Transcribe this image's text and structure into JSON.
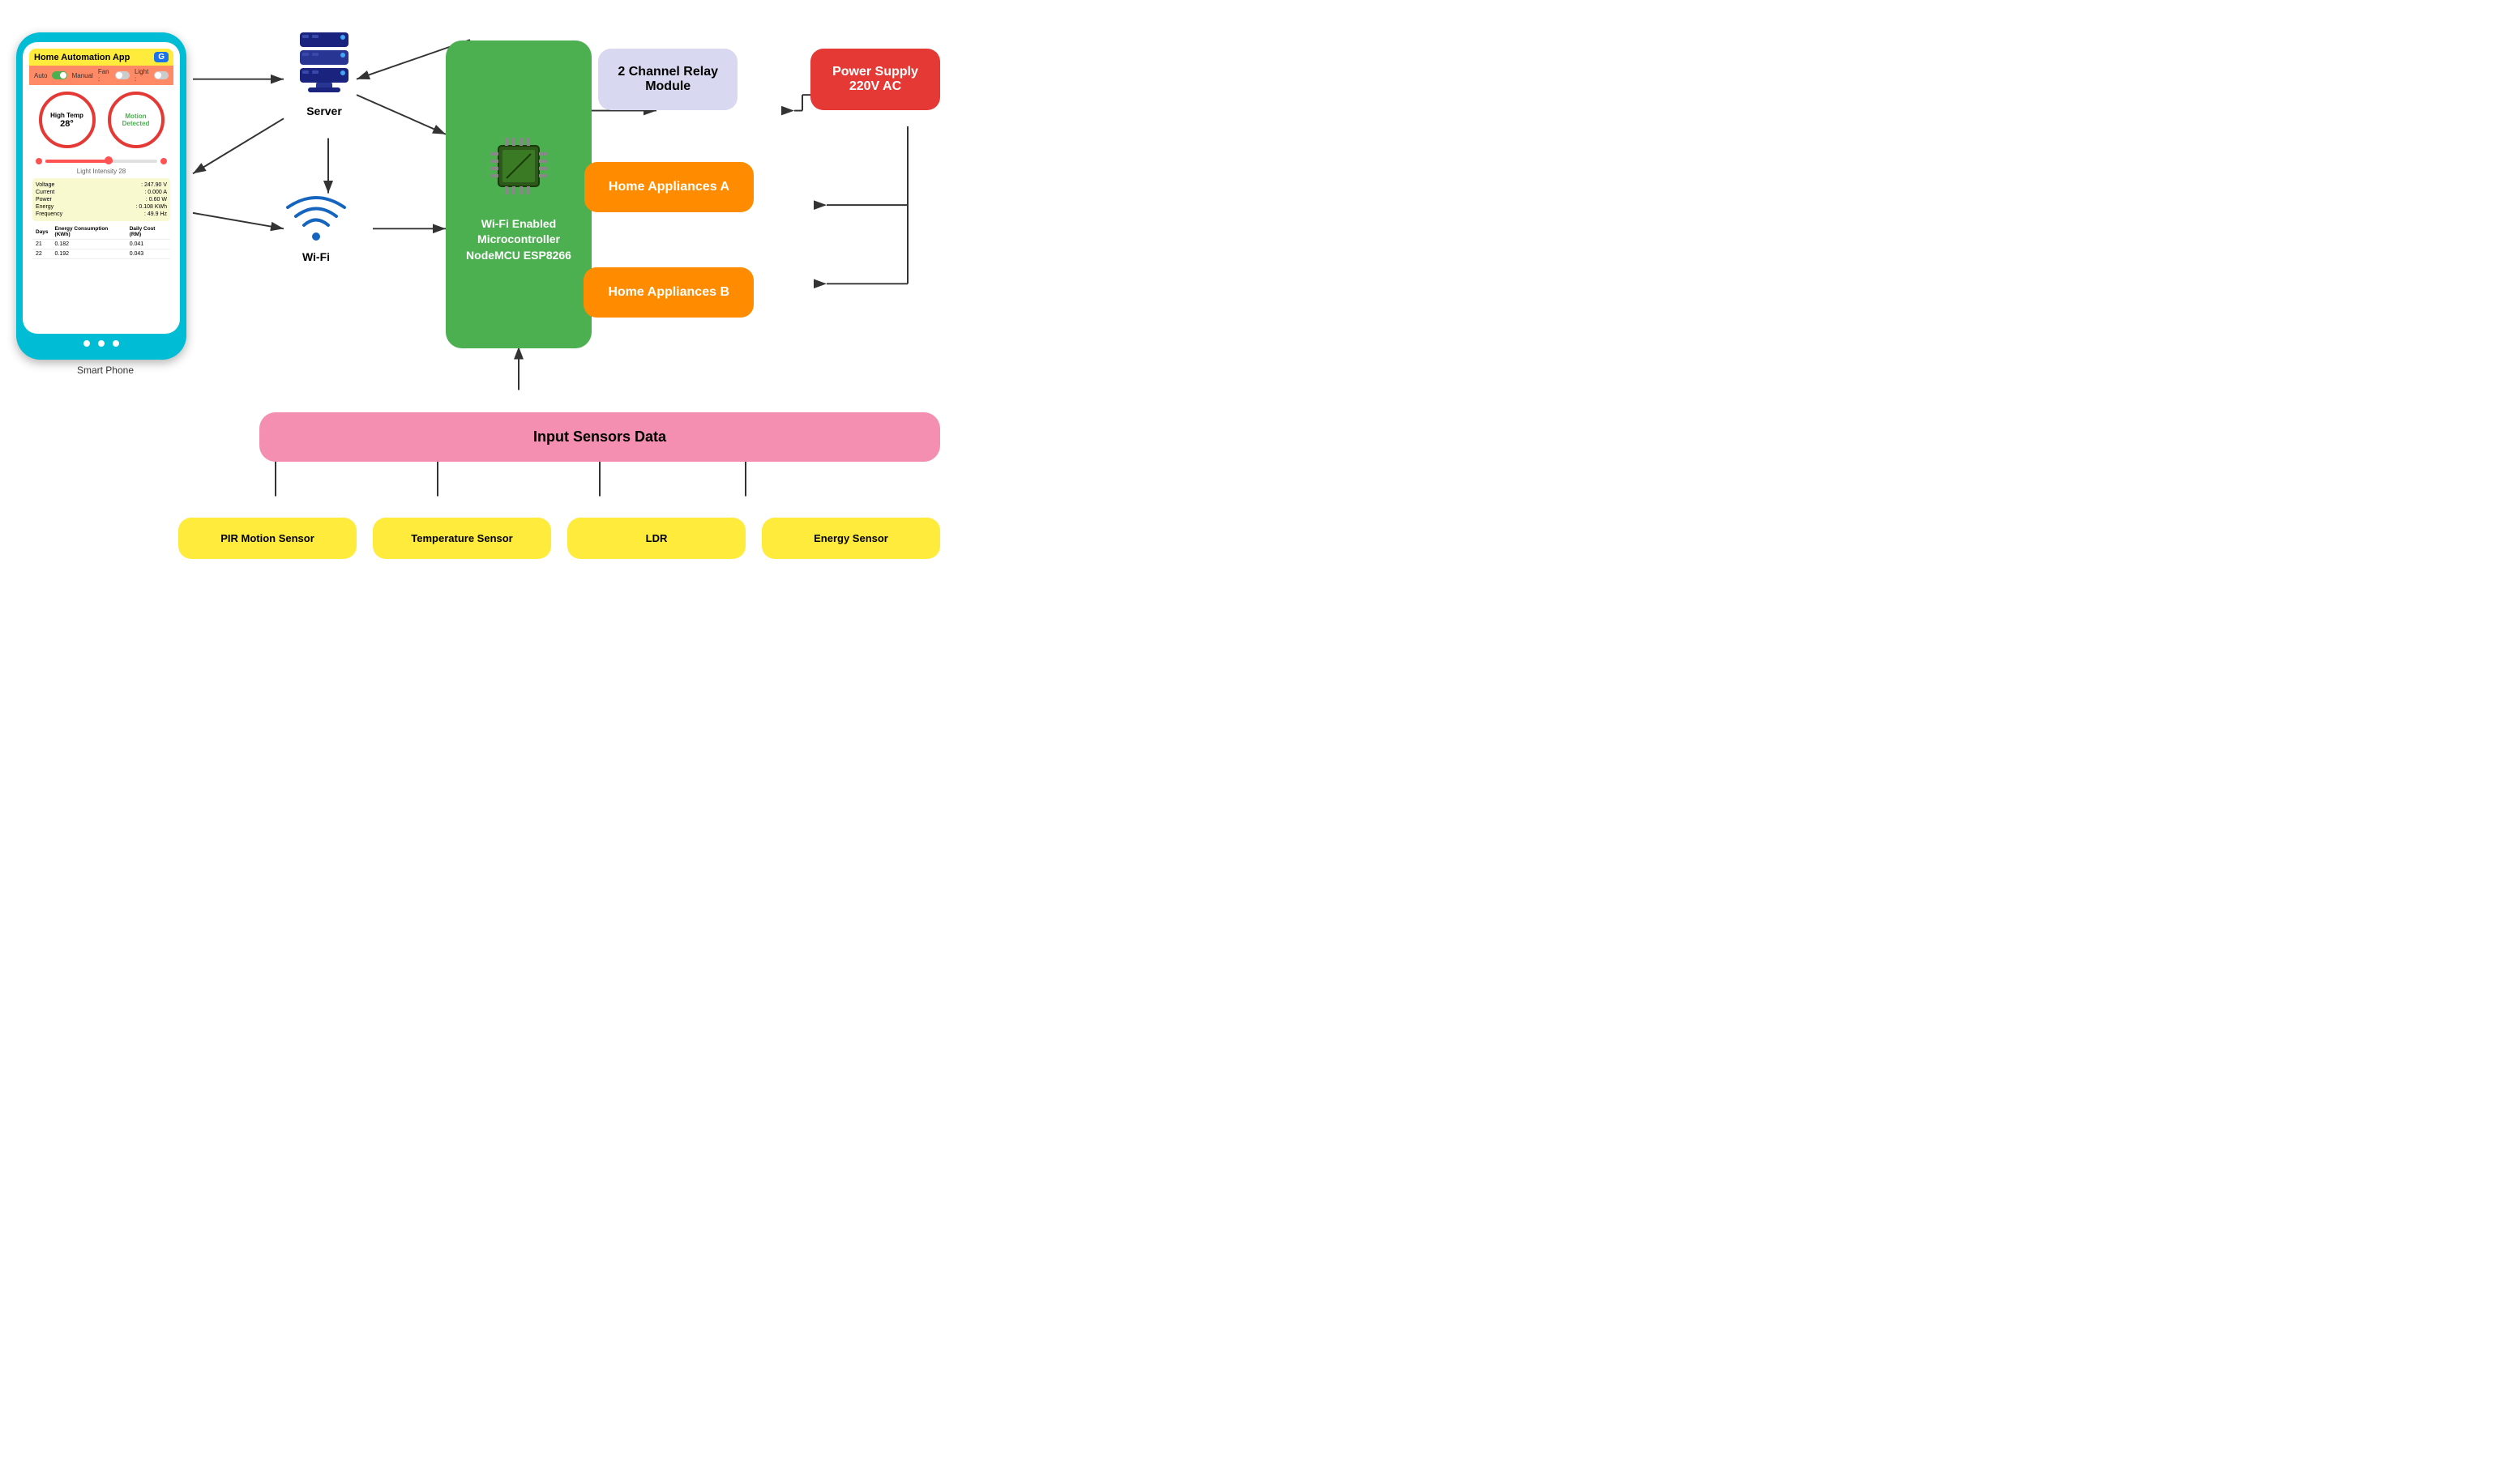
{
  "phone": {
    "title": "Home Automation App",
    "g_button": "G",
    "controls": {
      "auto_label": "Auto",
      "manual_label": "Manual",
      "fan_label": "Fan :",
      "light_label": "Light :"
    },
    "high_temp": "High Temp\n28 °",
    "high_temp_line1": "High Temp",
    "high_temp_line2": "28 °",
    "motion_detected": "Motion\nDetected",
    "motion_line1": "Motion",
    "motion_line2": "Detected",
    "light_intensity": "Light Intensity 28",
    "data_rows": [
      {
        "label": "Voltage",
        "value": ": 247.90 V"
      },
      {
        "label": "Current",
        "value": ": 0.000 A"
      },
      {
        "label": "Power",
        "value": ": 0.60 W"
      },
      {
        "label": "Energy",
        "value": ": 0.108 KWh"
      },
      {
        "label": "Frequency",
        "value": ": 49.9 Hz"
      }
    ],
    "energy_table": {
      "headers": [
        "Days",
        "Energy Consumption (KWh)",
        "Daily Cost (RM)"
      ],
      "rows": [
        {
          "day": "21",
          "energy": "0.182",
          "cost": "0.041"
        },
        {
          "day": "22",
          "energy": "0.192",
          "cost": "0.043"
        }
      ]
    }
  },
  "server": {
    "label": "Server"
  },
  "wifi": {
    "label": "Wi-Fi"
  },
  "mcu": {
    "label_line1": "Wi-Fi Enabled",
    "label_line2": "Microcontroller",
    "label_line3": "NodeMCU ESP8266"
  },
  "relay": {
    "label_line1": "2 Channel Relay",
    "label_line2": "Module"
  },
  "power_supply": {
    "label_line1": "Power Supply",
    "label_line2": "220V AC"
  },
  "appliance_a": {
    "label": "Home Appliances A"
  },
  "appliance_b": {
    "label": "Home Appliances B"
  },
  "sensors_data": {
    "label": "Input Sensors Data"
  },
  "sensor_boxes": [
    {
      "label": "PIR Motion Sensor"
    },
    {
      "label": "Temperature Sensor"
    },
    {
      "label": "LDR"
    },
    {
      "label": "Energy Sensor"
    }
  ]
}
